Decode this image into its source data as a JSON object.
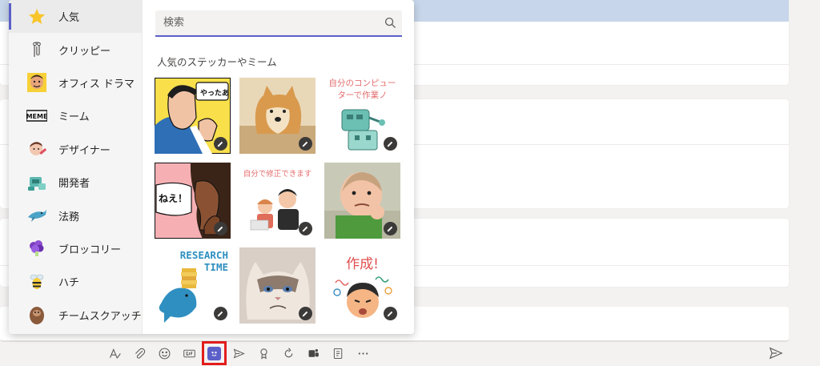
{
  "sidebar": {
    "categories": [
      {
        "label": "人気",
        "icon": "star-icon"
      },
      {
        "label": "クリッピー",
        "icon": "paperclip-icon"
      },
      {
        "label": "オフィス ドラマ",
        "icon": "office-drama-icon"
      },
      {
        "label": "ミーム",
        "icon": "meme-icon"
      },
      {
        "label": "デザイナー",
        "icon": "designer-icon"
      },
      {
        "label": "開発者",
        "icon": "developer-icon"
      },
      {
        "label": "法務",
        "icon": "legal-icon"
      },
      {
        "label": "ブロッコリー",
        "icon": "broccoli-icon"
      },
      {
        "label": "ハチ",
        "icon": "bee-icon"
      },
      {
        "label": "チームスクアッチ",
        "icon": "team-squatch-icon"
      }
    ]
  },
  "search": {
    "placeholder": "検索"
  },
  "section": {
    "title": "人気のステッカーやミーム"
  },
  "stickers": [
    {
      "name": "comic-man-sticker",
      "caption": "やったあ!"
    },
    {
      "name": "doge-sticker",
      "caption": ""
    },
    {
      "name": "robot-computer-sticker",
      "caption": "自分のコンピューターで作業ノ"
    },
    {
      "name": "comic-woman-sticker",
      "caption": "ねえ！"
    },
    {
      "name": "edit-people-sticker",
      "caption": "自分で修正できます"
    },
    {
      "name": "success-kid-sticker",
      "caption": ""
    },
    {
      "name": "research-time-sticker",
      "caption": "RESEARCH TIME"
    },
    {
      "name": "grumpy-cat-sticker",
      "caption": ""
    },
    {
      "name": "create-sticker",
      "caption": "作成!"
    }
  ],
  "colors": {
    "accent": "#5b5fc7",
    "highlight": "#e31c1c"
  }
}
